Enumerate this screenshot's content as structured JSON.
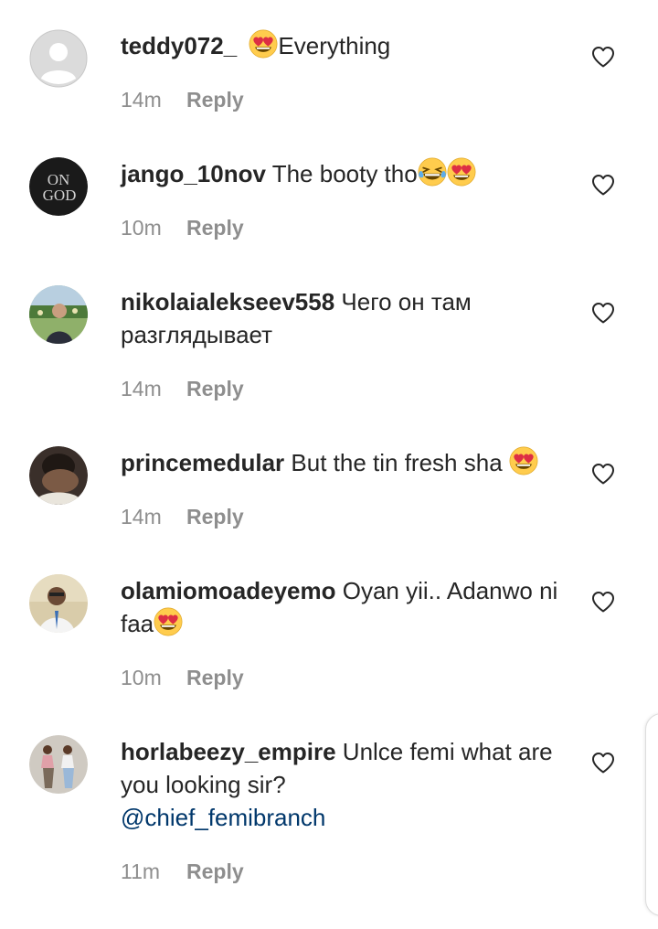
{
  "comments": [
    {
      "username": "teddy072_",
      "text": "Everything",
      "time": "14m",
      "reply": "Reply",
      "avatar": "default-avatar",
      "avatar_color": "#d8d8d8"
    },
    {
      "username": "jango_10nov",
      "text": "The booty tho",
      "time": "10m",
      "reply": "Reply",
      "avatar": "on-god-avatar",
      "avatar_color": "#1a1a1a",
      "avatar_text": [
        "ON",
        "GOD"
      ]
    },
    {
      "username": "nikolaialekseev558",
      "text": "Чего он там разглядывает",
      "time": "14m",
      "reply": "Reply",
      "avatar": "photo-avatar",
      "avatar_color": "#5a7a45"
    },
    {
      "username": "princemedular",
      "text": "But the tin fresh sha ",
      "time": "14m",
      "reply": "Reply",
      "avatar": "photo-avatar",
      "avatar_color": "#3a2f2a"
    },
    {
      "username": "olamiomoadeyemo",
      "text": "Oyan yii.. Adanwo ni faa",
      "time": "10m",
      "reply": "Reply",
      "avatar": "photo-avatar",
      "avatar_color": "#c8b68e"
    },
    {
      "username": "horlabeezy_empire",
      "text": "Unlce femi what are you looking sir?",
      "mention": "@chief_femibranch",
      "time": "11m",
      "reply": "Reply",
      "avatar": "photo-avatar",
      "avatar_color": "#c9c4bc"
    }
  ],
  "emoji": {
    "heart_eyes": "heart-eyes-emoji",
    "joy": "tears-of-joy-emoji"
  },
  "icons": {
    "like": "heart-outline-icon"
  },
  "colors": {
    "username": "#262626",
    "meta": "#8e8e8e",
    "mention": "#00376b"
  }
}
